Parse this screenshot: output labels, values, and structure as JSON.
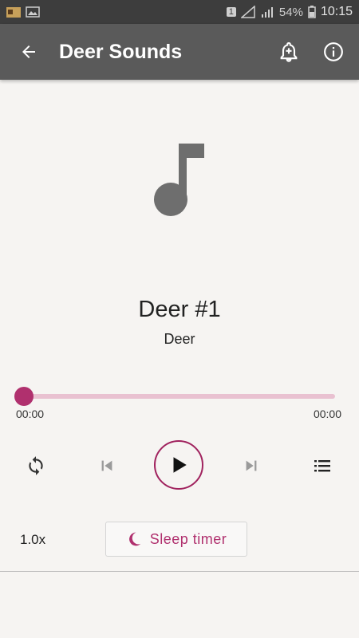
{
  "status_bar": {
    "battery": "54%",
    "time": "10:15",
    "sim": "1"
  },
  "app_bar": {
    "title": "Deer Sounds"
  },
  "track": {
    "title": "Deer #1",
    "subtitle": "Deer"
  },
  "progress": {
    "fraction": 0.0,
    "elapsed": "00:00",
    "duration": "00:00"
  },
  "speed": "1.0x",
  "sleep_timer": {
    "label": "Sleep timer"
  },
  "colors": {
    "accent": "#b0306e",
    "toolbar": "#5a5a5a",
    "status_bar": "#3d3d3d",
    "background": "#f6f4f2"
  }
}
